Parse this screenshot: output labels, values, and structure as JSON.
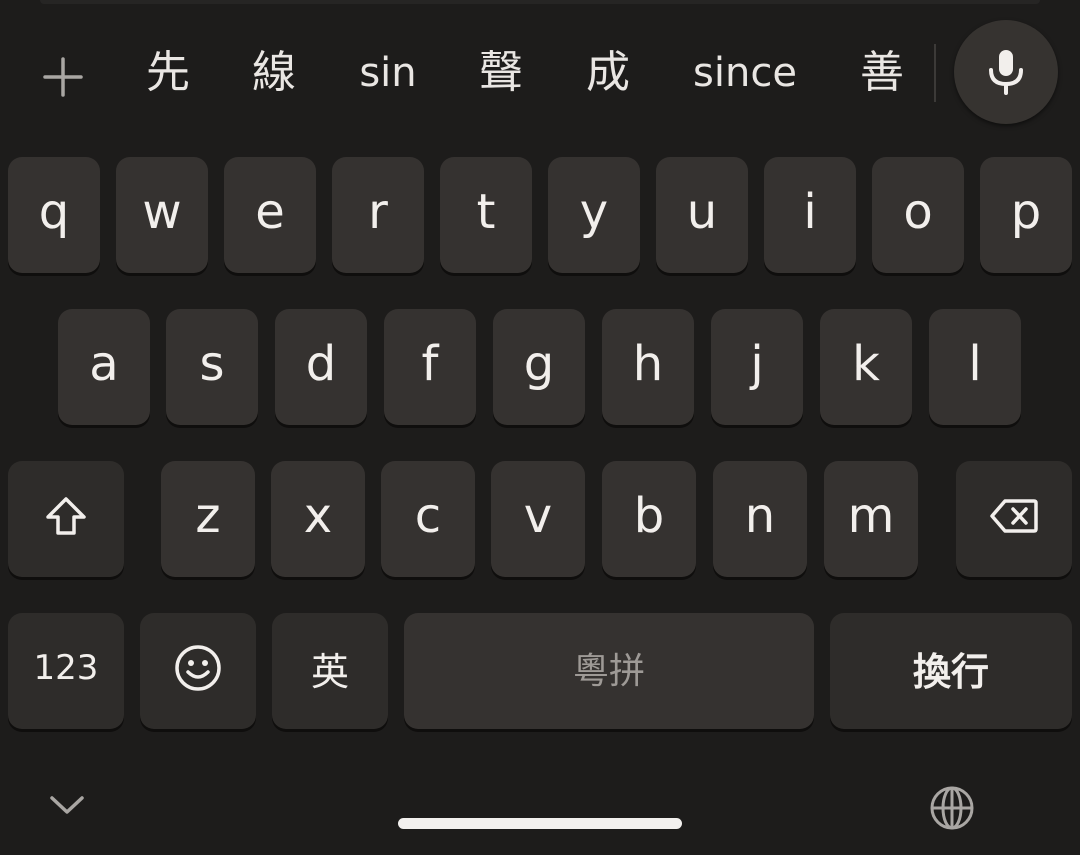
{
  "toolbar": {
    "add_icon": "plus-icon",
    "mic_icon": "microphone-icon"
  },
  "suggestions": [
    "先",
    "線",
    "sin",
    "聲",
    "成",
    "since",
    "善"
  ],
  "rows": {
    "row1": [
      "q",
      "w",
      "e",
      "r",
      "t",
      "y",
      "u",
      "i",
      "o",
      "p"
    ],
    "row2": [
      "a",
      "s",
      "d",
      "f",
      "g",
      "h",
      "j",
      "k",
      "l"
    ],
    "row3": [
      "z",
      "x",
      "c",
      "v",
      "b",
      "n",
      "m"
    ]
  },
  "keys": {
    "shift_icon": "shift-icon",
    "backspace_icon": "backspace-icon",
    "numbers": "123",
    "emoji_icon": "emoji-icon",
    "lang_switch": "英",
    "space": "粵拼",
    "enter": "換行"
  },
  "nav": {
    "hide_icon": "chevron-down-icon",
    "globe_icon": "globe-icon"
  },
  "colors": {
    "background": "#1d1c1b",
    "key": "#353230",
    "key_text": "#f2efec"
  }
}
